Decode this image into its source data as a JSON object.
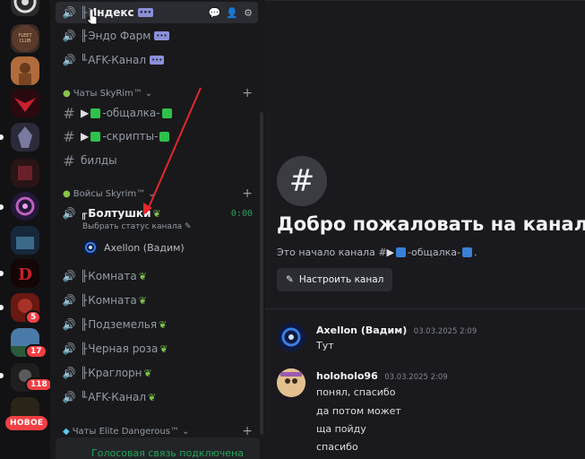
{
  "channels": {
    "voice_top": [
      {
        "label": "Индекс",
        "pill": "•••",
        "active": true
      },
      {
        "label": "Эндо Фарм",
        "pill": "•••"
      },
      {
        "label": "AFK-Канал",
        "pill": "•••"
      }
    ],
    "cat_chats": {
      "label": "Чаты SkyRim™"
    },
    "text_channels": [
      {
        "label": "-общалка-"
      },
      {
        "label": "-скрипты-"
      },
      {
        "label": "билды"
      }
    ],
    "cat_voice": {
      "label": "Войсы Skyrim™"
    },
    "voice_current": {
      "label": "Болтушки",
      "timer": "0:00",
      "status_placeholder": "Выбрать статус канала",
      "user": "Axellon (Вадим)"
    },
    "voice_rooms": [
      {
        "label": "Комната"
      },
      {
        "label": "Комната"
      },
      {
        "label": "Подземелья"
      },
      {
        "label": "Черная роза"
      },
      {
        "label": "Краглорн"
      },
      {
        "label": "AFK-Канал"
      }
    ],
    "cat_elite": {
      "label": "Чаты Elite Dangerous™"
    },
    "voice_connected": "Голосовая связь подключена"
  },
  "servers": {
    "badges": [
      "5",
      "17",
      "118"
    ],
    "new_pill": "НОВОЕ"
  },
  "main": {
    "welcome_title": "Добро пожаловать на канал #",
    "start_text": "Это начало канала #",
    "start_channel": "-общалка-",
    "setup_button": "Настроить канал",
    "messages": [
      {
        "author": "Axellon (Вадим)",
        "time": "03.03.2025 2:09",
        "lines": [
          "Тут"
        ]
      },
      {
        "author": "holoholo96",
        "time": "03.03.2025 2:09",
        "lines": [
          "понял, спасибо",
          "да потом может",
          "ща пойду",
          "спасибо"
        ]
      }
    ]
  },
  "colors": {
    "accent": "#23a55a",
    "badge": "#f23f43",
    "arrow": "#e5262b"
  }
}
